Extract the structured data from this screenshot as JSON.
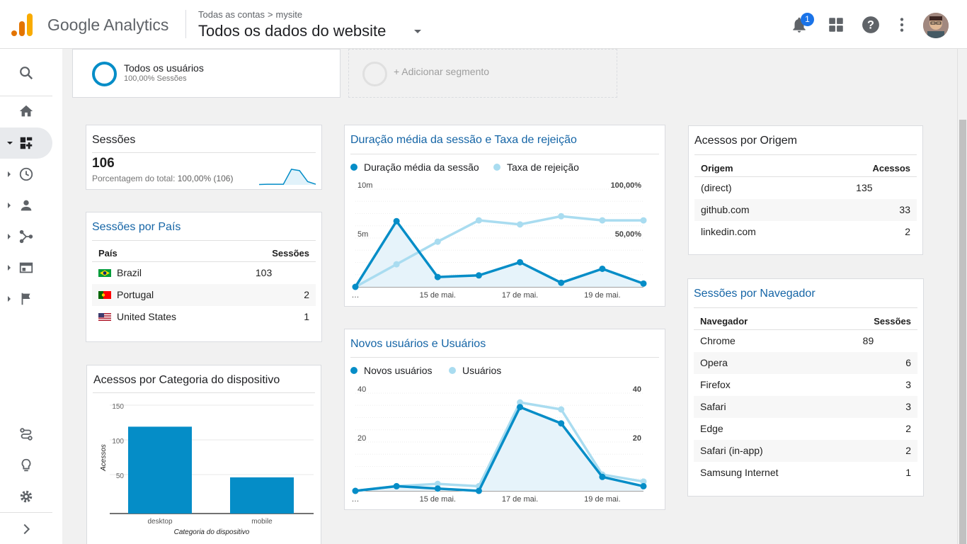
{
  "header": {
    "brand": "Google Analytics",
    "breadcrumb_all": "Todas as contas",
    "breadcrumb_sep": ">",
    "breadcrumb_site": "mysite",
    "view_title": "Todos os dados do website",
    "notifications_count": "1"
  },
  "segments": {
    "active_title": "Todos os usuários",
    "active_sub": "100,00% Sessões",
    "add_label": "+ Adicionar segmento"
  },
  "sessions_card": {
    "title": "Sessões",
    "value": "106",
    "sub_prefix": "Porcentagem do total: ",
    "sub_value": "100,00% (106)"
  },
  "country_card": {
    "title": "Sessões por País",
    "col1": "País",
    "col2": "Sessões",
    "rows": [
      {
        "name": "Brazil",
        "value": "103"
      },
      {
        "name": "Portugal",
        "value": "2"
      },
      {
        "name": "United States",
        "value": "1"
      }
    ]
  },
  "duration_card": {
    "title": "Duração média da sessão e Taxa de rejeição",
    "legend1": "Duração média da sessão",
    "legend2": "Taxa de rejeição"
  },
  "users_card": {
    "title": "Novos usuários e Usuários",
    "legend1": "Novos usuários",
    "legend2": "Usuários"
  },
  "device_card": {
    "title": "Acessos por Categoria do dispositivo"
  },
  "origin_card": {
    "title": "Acessos por Origem",
    "col1": "Origem",
    "col2": "Acessos",
    "rows": [
      {
        "name": "(direct)",
        "value": "135"
      },
      {
        "name": "github.com",
        "value": "33"
      },
      {
        "name": "linkedin.com",
        "value": "2"
      }
    ]
  },
  "browser_card": {
    "title": "Sessões por Navegador",
    "col1": "Navegador",
    "col2": "Sessões",
    "rows": [
      {
        "name": "Chrome",
        "value": "89"
      },
      {
        "name": "Opera",
        "value": "6"
      },
      {
        "name": "Firefox",
        "value": "3"
      },
      {
        "name": "Safari",
        "value": "3"
      },
      {
        "name": "Edge",
        "value": "2"
      },
      {
        "name": "Safari (in-app)",
        "value": "2"
      },
      {
        "name": "Samsung Internet",
        "value": "1"
      }
    ]
  },
  "colors": {
    "series_dark": "#058dc7",
    "series_light": "#a9dcf0",
    "link": "#1565a6"
  },
  "chart_data": [
    {
      "type": "line",
      "id": "sessions_sparkline",
      "x": [
        1,
        2,
        3,
        4,
        5,
        6,
        7,
        8
      ],
      "series": [
        {
          "values": [
            1,
            2,
            2,
            2,
            47,
            43,
            10,
            2
          ]
        }
      ]
    },
    {
      "type": "area",
      "id": "duration_bounce",
      "x": [
        "…",
        "",
        "15 de mai.",
        "",
        "17 de mai.",
        "",
        "19 de mai.",
        ""
      ],
      "xticks": [
        "…",
        "15 de mai.",
        "17 de mai.",
        "19 de mai."
      ],
      "yticks_left": [
        "5m",
        "10m"
      ],
      "yticks_right": [
        "50,00%",
        "100,00%"
      ],
      "series": [
        {
          "name": "Duração média da sessão",
          "unit": "minutes",
          "values": [
            0,
            8.0,
            1.2,
            1.4,
            3.0,
            0.5,
            2.2,
            0.4
          ]
        },
        {
          "name": "Taxa de rejeição",
          "unit": "percent",
          "values": [
            0,
            27.5,
            55,
            81,
            76,
            86,
            81,
            81
          ]
        }
      ],
      "ylim_left": [
        0,
        10
      ],
      "ylim_right": [
        0,
        100
      ]
    },
    {
      "type": "area",
      "id": "new_users",
      "x": [
        "…",
        "",
        "15 de mai.",
        "",
        "17 de mai.",
        "",
        "19 de mai.",
        ""
      ],
      "xticks": [
        "…",
        "15 de mai.",
        "17 de mai.",
        "19 de mai."
      ],
      "yticks_left": [
        "20",
        "40"
      ],
      "yticks_right": [
        "20",
        "40"
      ],
      "series": [
        {
          "name": "Novos usuários",
          "values": [
            0,
            2,
            1,
            0,
            36,
            29,
            6,
            2
          ]
        },
        {
          "name": "Usuários",
          "values": [
            0,
            2,
            3,
            2,
            38,
            35,
            7,
            4
          ]
        }
      ],
      "ylim": [
        0,
        40
      ]
    },
    {
      "type": "bar",
      "id": "device_category",
      "categories": [
        "desktop",
        "mobile"
      ],
      "values": [
        119,
        46
      ],
      "xlabel": "Categoria do dispositivo",
      "ylabel": "Acessos",
      "yticks": [
        "50",
        "100",
        "150"
      ],
      "ylim": [
        0,
        150
      ]
    }
  ]
}
